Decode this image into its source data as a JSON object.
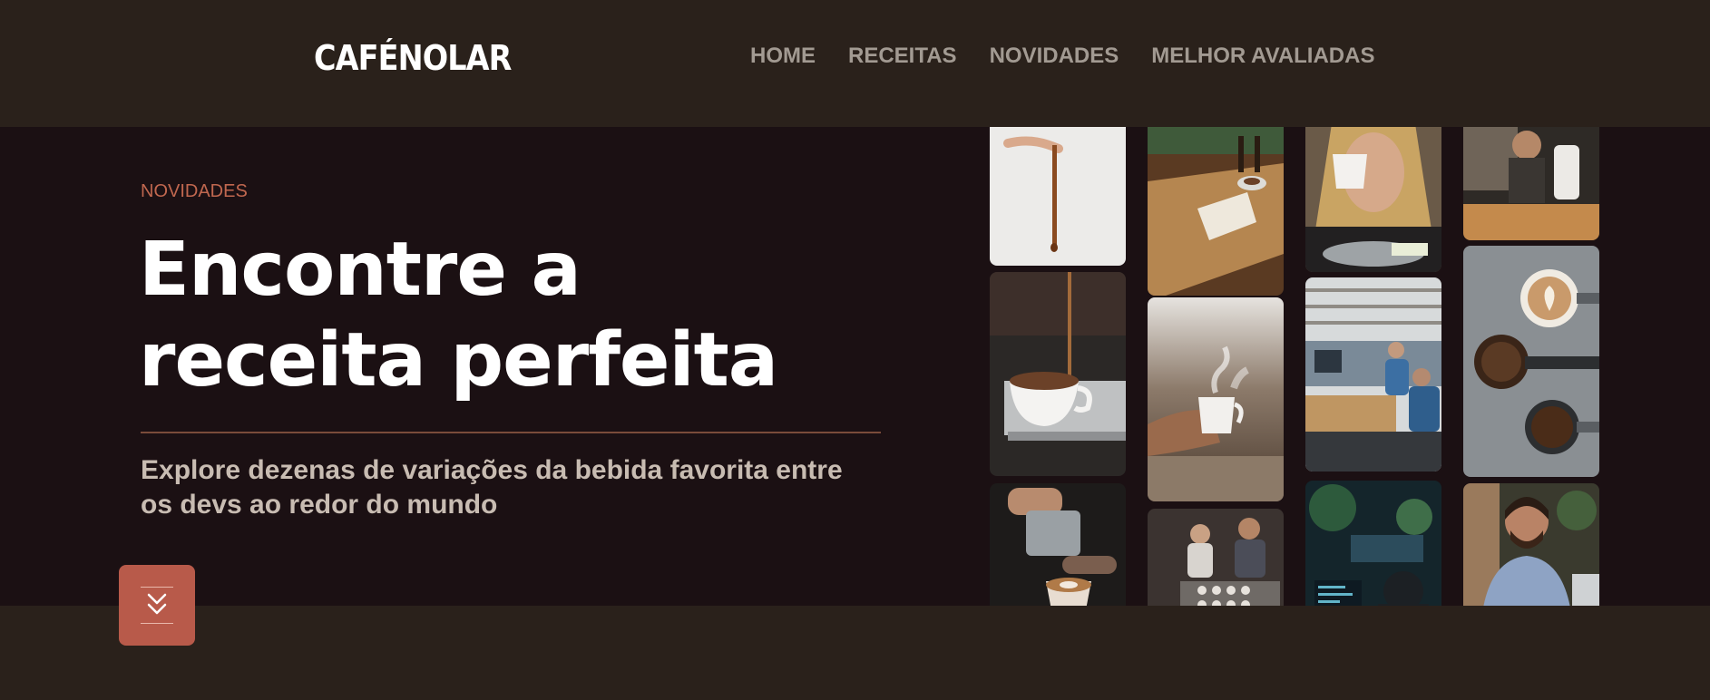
{
  "brand": {
    "name": "CAFÉNOLAR"
  },
  "nav": {
    "items": [
      "HOME",
      "RECEITAS",
      "NOVIDADES",
      "MELHOR AVALIADAS"
    ]
  },
  "hero": {
    "eyebrow": "NOVIDADES",
    "title_line1": "Encontre a",
    "title_line2": "receita perfeita",
    "subtitle_line1": "Explore dezenas de variações da bebida favorita entre",
    "subtitle_line2": "os devs ao redor do mundo"
  },
  "gallery": {
    "photos": [
      "coffee-pour-photo",
      "coffee-table-photo",
      "woman-drinking-coffee-photo",
      "barista-photo",
      "espresso-cup-photo",
      "steaming-mug-photo",
      "office-meeting-photo",
      "latte-art-photo",
      "latte-pour-photo",
      "coffee-workshop-photo",
      "developer-screens-photo",
      "smiling-man-photo"
    ]
  },
  "scroll_button": {
    "icon": "chevrons-down-icon"
  },
  "colors": {
    "header_bg": "#2a211b",
    "hero_bg": "#1b1013",
    "accent": "#b85a4a",
    "eyebrow": "#c0674f",
    "nav_text": "#a29a92"
  }
}
